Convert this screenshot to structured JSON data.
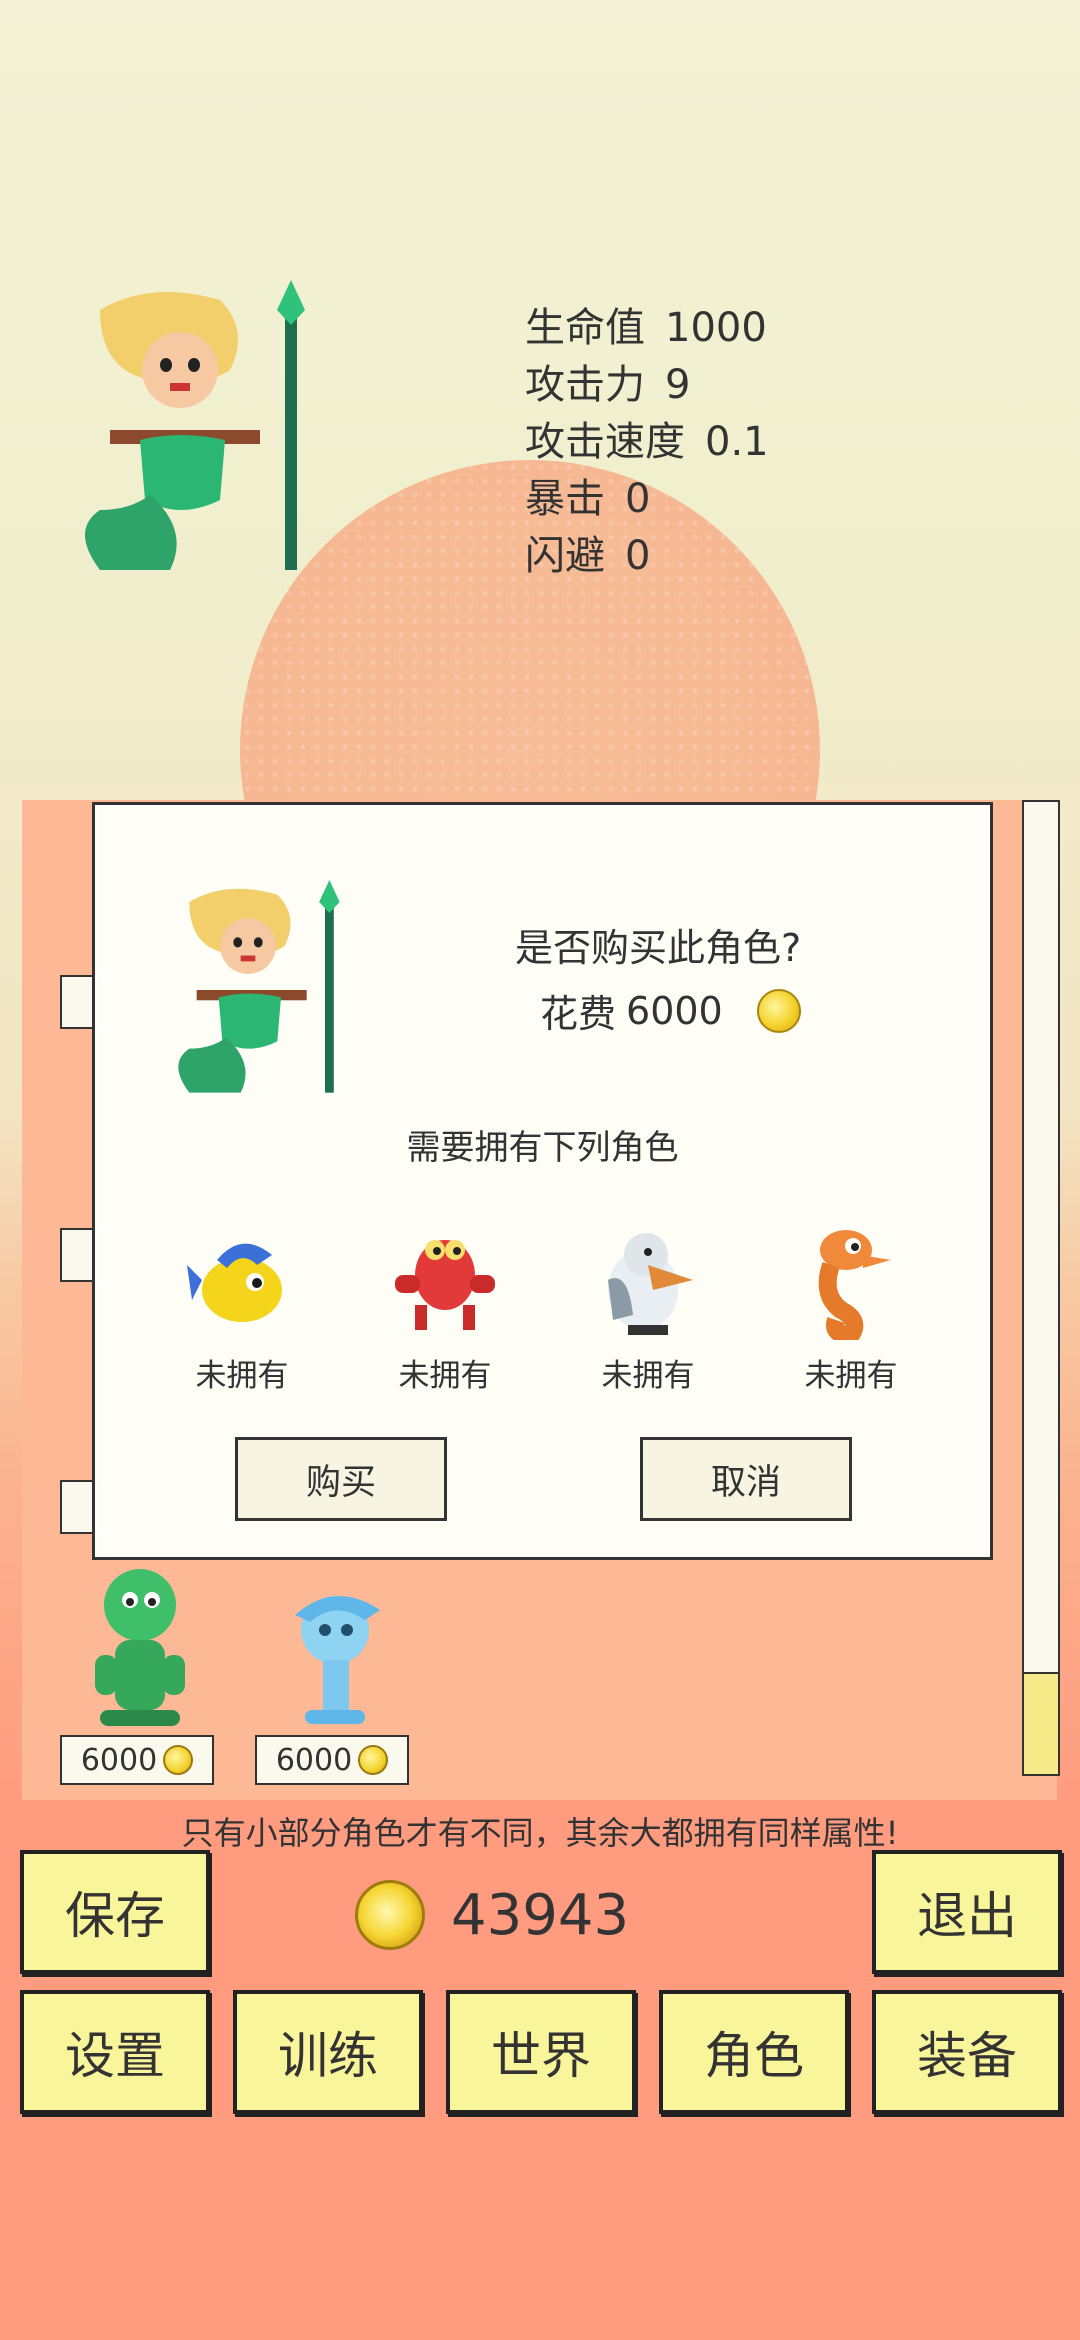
{
  "stats": [
    {
      "label": "生命值",
      "value": "1000"
    },
    {
      "label": "攻击力",
      "value": "9"
    },
    {
      "label": "攻击速度",
      "value": "0.1"
    },
    {
      "label": "暴击",
      "value": "0"
    },
    {
      "label": "闪避",
      "value": "0"
    }
  ],
  "dialog": {
    "question": "是否购买此角色?",
    "cost_label": "花费",
    "cost_value": "6000",
    "need_text": "需要拥有下列角色",
    "required": [
      {
        "name": "yellow-fish",
        "status": "未拥有"
      },
      {
        "name": "red-crab",
        "status": "未拥有"
      },
      {
        "name": "pelican",
        "status": "未拥有"
      },
      {
        "name": "seahorse",
        "status": "未拥有"
      }
    ],
    "buy_label": "购买",
    "cancel_label": "取消"
  },
  "shop": {
    "cards": [
      {
        "name": "green-seahorse",
        "price": "6000"
      },
      {
        "name": "water-spirit",
        "price": "6000"
      }
    ]
  },
  "hint": "只有小部分角色才有不同，其余大都拥有同样属性!",
  "bottom": {
    "save_label": "保存",
    "gold": "43943",
    "exit_label": "退出",
    "nav": [
      "设置",
      "训练",
      "世界",
      "角色",
      "装备"
    ]
  },
  "colors": {
    "button_bg": "#f8f59a",
    "panel_bg": "#fdb896",
    "dialog_bg": "#fefdf6",
    "coin": "#f4d22c"
  }
}
